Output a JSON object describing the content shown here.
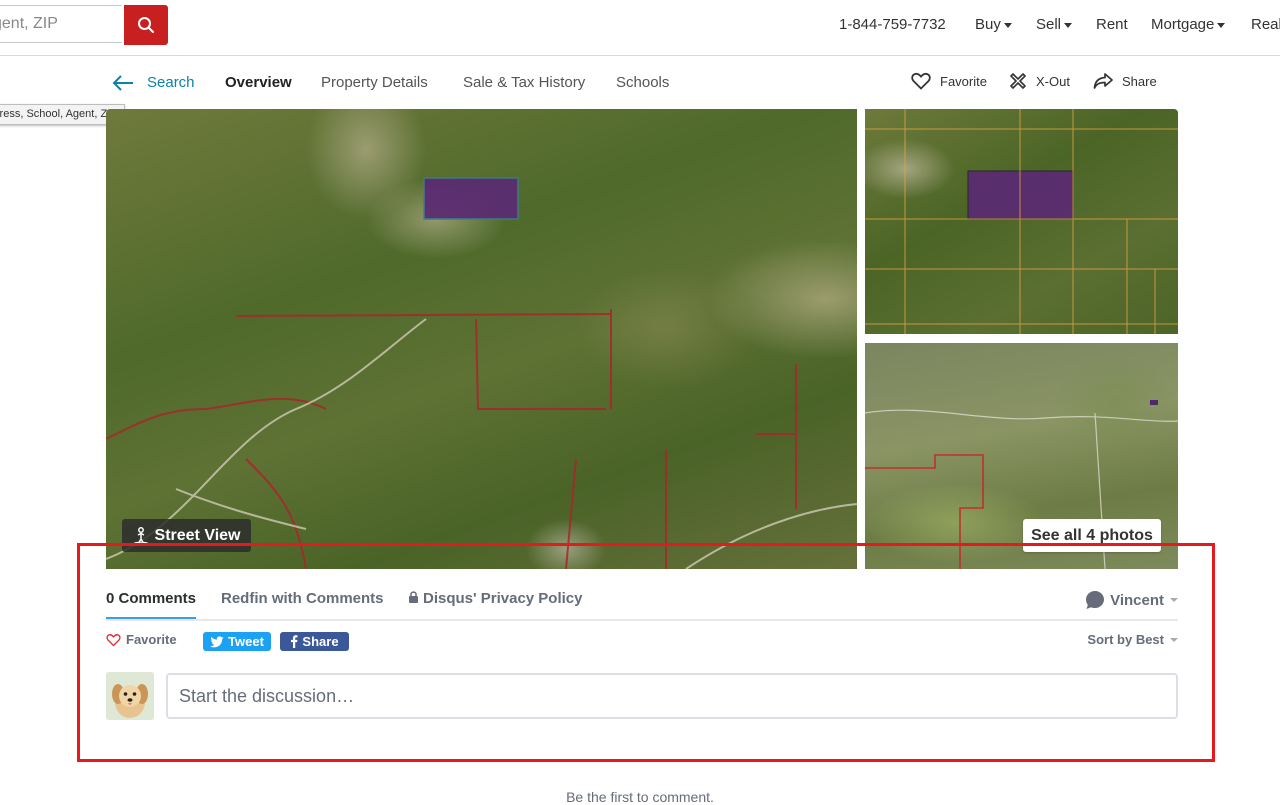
{
  "header": {
    "search_placeholder": "Address, School, Agent, ZIP",
    "search_visible_text": "gent, ZIP",
    "nav": {
      "phone": "1-844-759-7732",
      "buy": "Buy",
      "sell": "Sell",
      "rent": "Rent",
      "mortgage": "Mortgage",
      "real": "Real"
    }
  },
  "tooltip": {
    "text": "ldress, School, Agent, ZIP"
  },
  "subnav": {
    "back": "Search",
    "tabs": [
      "Overview",
      "Property Details",
      "Sale & Tax History",
      "Schools"
    ],
    "actions": {
      "favorite": "Favorite",
      "xout": "X-Out",
      "share": "Share"
    }
  },
  "photos": {
    "street_view": "Street View",
    "see_all": "See all 4 photos"
  },
  "comments": {
    "tabs": {
      "count": "0 Comments",
      "community": "Redfin with Comments",
      "privacy": "Disqus' Privacy Policy"
    },
    "user": "Vincent",
    "favorite": "Favorite",
    "tweet": "Tweet",
    "share": "Share",
    "sort": "Sort by Best",
    "input_placeholder": "Start the discussion…",
    "first_comment": "Be the first to comment."
  },
  "colors": {
    "brand_red": "#c82021",
    "twitter_blue": "#1da1f2",
    "facebook_blue": "#3b5998",
    "active_tab": "#2e9fff",
    "annotation_red": "#e8191c"
  }
}
